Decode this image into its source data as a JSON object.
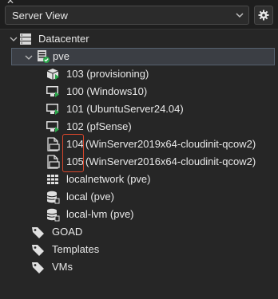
{
  "header": {
    "corner_mark": "✕",
    "view_select_value": "Server View"
  },
  "tree": {
    "datacenter": "Datacenter",
    "node": "pve",
    "vms": [
      {
        "label": "103 (provisioning)",
        "status": "running",
        "icon": "vm-running-icon"
      },
      {
        "label": "100 (Windows10)",
        "status": "running",
        "icon": "vm-running-icon"
      },
      {
        "label": "101 (UbuntuServer24.04)",
        "status": "running",
        "icon": "vm-running-icon"
      },
      {
        "label": "102 (pfSense)",
        "status": "running",
        "icon": "vm-running-icon"
      }
    ],
    "templates": [
      {
        "id": "104",
        "name": "(WinServer2019x64-cloudinit-qcow2)",
        "icon": "template-icon"
      },
      {
        "id": "105",
        "name": "(WinServer2016x64-cloudinit-qcow2)",
        "icon": "template-icon"
      }
    ],
    "network": "localnetwork (pve)",
    "storage": [
      {
        "label": "local (pve)",
        "icon": "storage-icon"
      },
      {
        "label": "local-lvm (pve)",
        "icon": "storage-icon"
      }
    ],
    "tags": [
      {
        "label": "GOAD",
        "icon": "tag-icon"
      },
      {
        "label": "Templates",
        "icon": "tag-icon"
      },
      {
        "label": "VMs",
        "icon": "tag-icon"
      }
    ]
  },
  "colors": {
    "running": "#2aa64a",
    "highlight": "#d8462b",
    "selection": "#3b3e44"
  }
}
